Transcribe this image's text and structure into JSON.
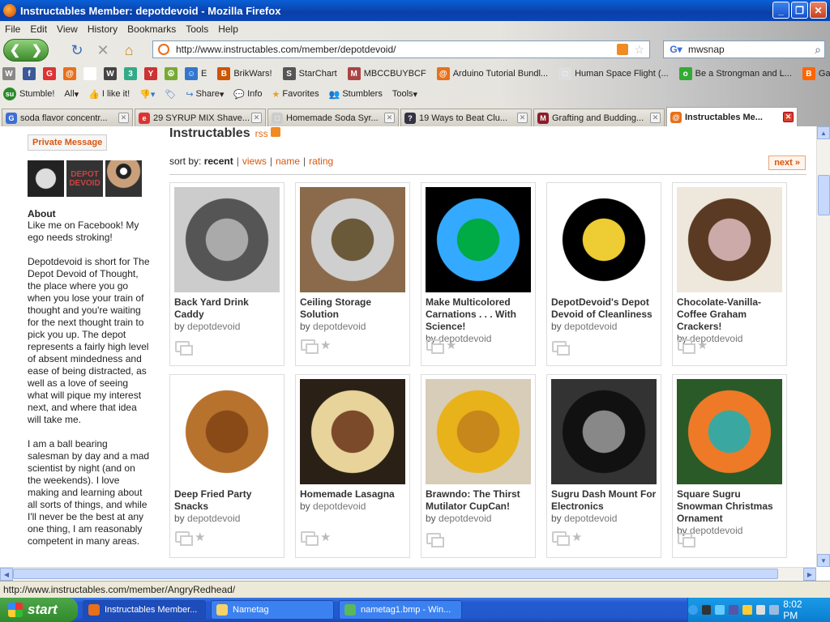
{
  "window": {
    "title": "Instructables Member: depotdevoid - Mozilla Firefox"
  },
  "menu": [
    "File",
    "Edit",
    "View",
    "History",
    "Bookmarks",
    "Tools",
    "Help"
  ],
  "nav": {
    "url": "http://www.instructables.com/member/depotdevoid/",
    "search_value": "mwsnap"
  },
  "bookmarks": [
    {
      "label": "",
      "icon": "W",
      "color": "#888"
    },
    {
      "label": "",
      "icon": "f",
      "color": "#3b5998"
    },
    {
      "label": "",
      "icon": "G",
      "color": "#d33"
    },
    {
      "label": "",
      "icon": "@",
      "color": "#e8701a"
    },
    {
      "label": "",
      "icon": "O",
      "color": "#fff"
    },
    {
      "label": "",
      "icon": "W",
      "color": "#444"
    },
    {
      "label": "",
      "icon": "3",
      "color": "#3a8"
    },
    {
      "label": "",
      "icon": "Y",
      "color": "#c33"
    },
    {
      "label": "",
      "icon": "☮",
      "color": "#7a3"
    },
    {
      "label": "E",
      "icon": "☺",
      "color": "#37c"
    },
    {
      "label": "BrikWars!",
      "icon": "B",
      "color": "#c50"
    },
    {
      "label": "StarChart",
      "icon": "S",
      "color": "#555"
    },
    {
      "label": "MBCCBUYBCF",
      "icon": "M",
      "color": "#a44"
    },
    {
      "label": "Arduino Tutorial Bundl...",
      "icon": "@",
      "color": "#e8701a"
    },
    {
      "label": "Human Space Flight (...",
      "icon": "□",
      "color": "#ddd"
    },
    {
      "label": "Be a Strongman and L...",
      "icon": "o",
      "color": "#3a3"
    },
    {
      "label": "Gaia Gamma",
      "icon": "B",
      "color": "#f60"
    }
  ],
  "stumblebar": {
    "stumble": "Stumble!",
    "all": "All",
    "ilike": "I like it!",
    "share": "Share",
    "info": "Info",
    "favorites": "Favorites",
    "stumblers": "Stumblers",
    "tools": "Tools"
  },
  "tabs": [
    {
      "label": "soda flavor concentr...",
      "icon": "G",
      "color": "#3b6ed6",
      "active": false
    },
    {
      "label": "29 SYRUP MIX Shave...",
      "icon": "e",
      "color": "#d33",
      "active": false
    },
    {
      "label": "Homemade Soda Syr...",
      "icon": "□",
      "color": "#ccc",
      "active": false
    },
    {
      "label": "19 Ways to Beat Clu...",
      "icon": "?",
      "color": "#334",
      "active": false
    },
    {
      "label": "Grafting and Budding...",
      "icon": "M",
      "color": "#8a1d2a",
      "active": false
    },
    {
      "label": "Instructables Me...",
      "icon": "@",
      "color": "#e8701a",
      "active": true
    }
  ],
  "sidebar": {
    "pm_label": "Private Message",
    "about_heading": "About",
    "about_paragraphs": [
      "Like me on Facebook! My ego needs stroking!",
      "Depotdevoid is short for The Depot Devoid of Thought, the place where you go when you lose your train of thought and you're waiting for the next thought train to pick you up. The depot represents a fairly high level of absent mindedness and ease of being distracted, as well as a love of seeing what will pique my interest next, and where that idea will take me.",
      "I am a ball bearing salesman by day and a mad scientist by night (and on the weekends). I love making and learning about all sorts of things, and while I'll never be the best at any one thing, I am reasonably competent in many areas."
    ]
  },
  "main": {
    "heading": "Instructables",
    "rss": "rss",
    "sort_prefix": "sort by:",
    "sort_current": "recent",
    "sort_options": [
      "views",
      "name",
      "rating"
    ],
    "next_label": "next »",
    "by_prefix": "by",
    "cards": [
      {
        "title": "Back Yard Drink Caddy",
        "author": "depotdevoid",
        "fav": false,
        "colors": [
          "#ccc",
          "#555",
          "#aaa"
        ]
      },
      {
        "title": "Ceiling Storage Solution",
        "author": "depotdevoid",
        "fav": true,
        "colors": [
          "#8a6a4a",
          "#cfcfcf",
          "#6a5a3a"
        ]
      },
      {
        "title": "Make Multicolored Carnations . . . With Science!",
        "author": "depotdevoid",
        "fav": true,
        "colors": [
          "#000",
          "#3af",
          "#0a4"
        ]
      },
      {
        "title": "DepotDevoid's Depot Devoid of Cleanliness",
        "author": "depotdevoid",
        "fav": false,
        "colors": [
          "#fff",
          "#000",
          "#ec3"
        ]
      },
      {
        "title": "Chocolate-Vanilla-Coffee Graham Crackers!",
        "author": "depotdevoid",
        "fav": true,
        "colors": [
          "#eee8dc",
          "#5a3a22",
          "#caa"
        ]
      },
      {
        "title": "Deep Fried Party Snacks",
        "author": "depotdevoid",
        "fav": true,
        "colors": [
          "#fff",
          "#b7722e",
          "#8a4a18"
        ]
      },
      {
        "title": "Homemade Lasagna",
        "author": "depotdevoid",
        "fav": true,
        "colors": [
          "#2a2016",
          "#e8d49a",
          "#7a4a2a"
        ]
      },
      {
        "title": "Brawndo: The Thirst Mutilator CupCan!",
        "author": "depotdevoid",
        "fav": false,
        "colors": [
          "#d8cdb8",
          "#e8b21a",
          "#c8871a"
        ]
      },
      {
        "title": "Sugru Dash Mount For Electronics",
        "author": "depotdevoid",
        "fav": true,
        "colors": [
          "#333",
          "#111",
          "#888"
        ]
      },
      {
        "title": "Square Sugru Snowman Christmas Ornament",
        "author": "depotdevoid",
        "fav": false,
        "colors": [
          "#2a5a28",
          "#ee7a28",
          "#3aa8a0"
        ]
      }
    ]
  },
  "status": {
    "text": "http://www.instructables.com/member/AngryRedhead/"
  },
  "taskbar": {
    "start": "start",
    "tasks": [
      {
        "label": "Instructables Member...",
        "color": "#e8701a",
        "active": true
      },
      {
        "label": "Nametag",
        "color": "#f5d36a",
        "active": false
      },
      {
        "label": "nametag1.bmp - Win...",
        "color": "#5ab85a",
        "active": false
      }
    ],
    "clock": "8:02 PM"
  }
}
